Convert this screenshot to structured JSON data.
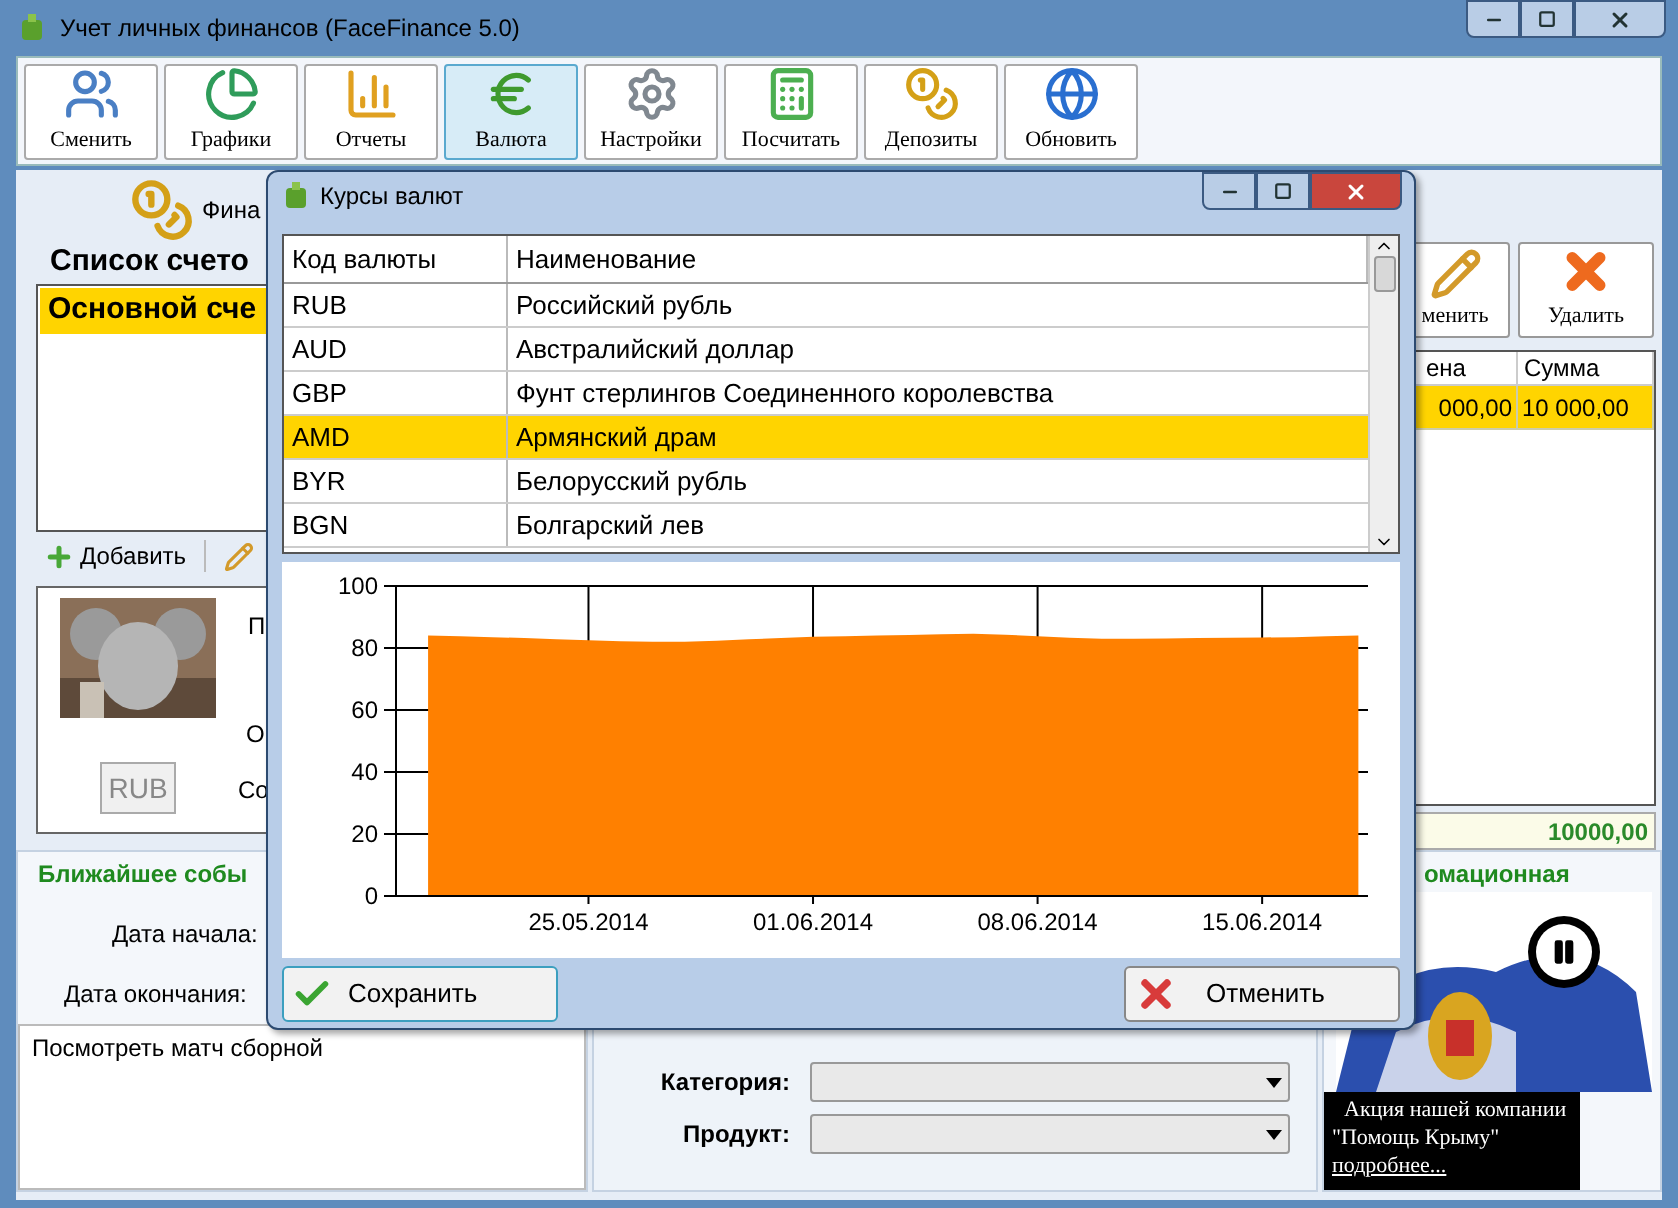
{
  "window": {
    "title": "Учет личных финансов (FaceFinance 5.0)"
  },
  "toolbar": [
    {
      "label": "Сменить",
      "kind": "users",
      "selected": false
    },
    {
      "label": "Графики",
      "kind": "pie",
      "selected": false
    },
    {
      "label": "Отчеты",
      "kind": "bars",
      "selected": false
    },
    {
      "label": "Валюта",
      "kind": "euro",
      "selected": true
    },
    {
      "label": "Настройки",
      "kind": "gear",
      "selected": false
    },
    {
      "label": "Посчитать",
      "kind": "calculator",
      "selected": false
    },
    {
      "label": "Депозиты",
      "kind": "coins",
      "selected": false
    },
    {
      "label": "Обновить",
      "kind": "globe",
      "selected": false
    }
  ],
  "finance_header": {
    "label": "Фина"
  },
  "accounts": {
    "title": "Список счето",
    "items": [
      {
        "label": "Основной сче",
        "selected": true
      }
    ],
    "add_button": "Добавить"
  },
  "profile": {
    "labels": [
      "П",
      "О",
      "Со"
    ],
    "currency_button": "RUB"
  },
  "operations": {
    "buttons": [
      {
        "label": "менить",
        "kind": "edit"
      },
      {
        "label": "Удалить",
        "kind": "delete"
      }
    ],
    "columns": [
      "ена",
      "Сумма"
    ],
    "rows": [
      {
        "cells": [
          "000,00",
          "10 000,00"
        ],
        "selected": true
      }
    ],
    "total": "10000,00"
  },
  "event": {
    "title": "Ближайшее собы",
    "start_label": "Дата начала:",
    "end_label": "Дата окончания:",
    "note": "Посмотреть матч сборной"
  },
  "filters": [
    {
      "label": "Категория:"
    },
    {
      "label": "Продукт:"
    }
  ],
  "promo": {
    "title": "омационная",
    "lines": [
      "Акция нашей компании",
      "\"Помощь Крыму\""
    ],
    "link": "подробнее..."
  },
  "dialog": {
    "title": "Курсы валют",
    "columns": [
      "Код валюты",
      "Наименование"
    ],
    "rows": [
      {
        "code": "RUB",
        "name": "Российский рубль",
        "selected": false
      },
      {
        "code": "AUD",
        "name": "Австралийский доллар",
        "selected": false
      },
      {
        "code": "GBP",
        "name": "Фунт стерлингов Соединенного королевства",
        "selected": false
      },
      {
        "code": "AMD",
        "name": "Армянский драм",
        "selected": true
      },
      {
        "code": "BYR",
        "name": "Белорусский рубль",
        "selected": false
      },
      {
        "code": "BGN",
        "name": "Болгарский лев",
        "selected": false
      }
    ],
    "chart_data": {
      "type": "area",
      "categories": [
        null,
        null,
        null,
        null,
        null,
        "25.05.2014",
        null,
        null,
        null,
        null,
        null,
        null,
        "01.06.2014",
        null,
        null,
        null,
        null,
        null,
        null,
        "08.06.2014",
        null,
        null,
        null,
        null,
        null,
        null,
        "15.06.2014",
        null,
        null,
        null
      ],
      "series": [
        {
          "color": "#ff8000",
          "values": [
            84,
            83.8,
            83.5,
            83.2,
            82.8,
            82.5,
            82.2,
            82,
            82,
            82.3,
            82.8,
            83.2,
            83.6,
            83.8,
            84,
            84.2,
            84.4,
            84.6,
            84.3,
            83.8,
            83.3,
            83,
            83,
            83.1,
            83.2,
            83.3,
            83.4,
            83.5,
            83.8,
            84
          ]
        }
      ],
      "ylim": [
        0,
        100
      ],
      "grid": true,
      "yticks": [
        0,
        20,
        40,
        60,
        80,
        100
      ]
    },
    "buttons": [
      {
        "label": "Сохранить",
        "kind": "save"
      },
      {
        "label": "Отменить",
        "kind": "cancel"
      }
    ]
  }
}
